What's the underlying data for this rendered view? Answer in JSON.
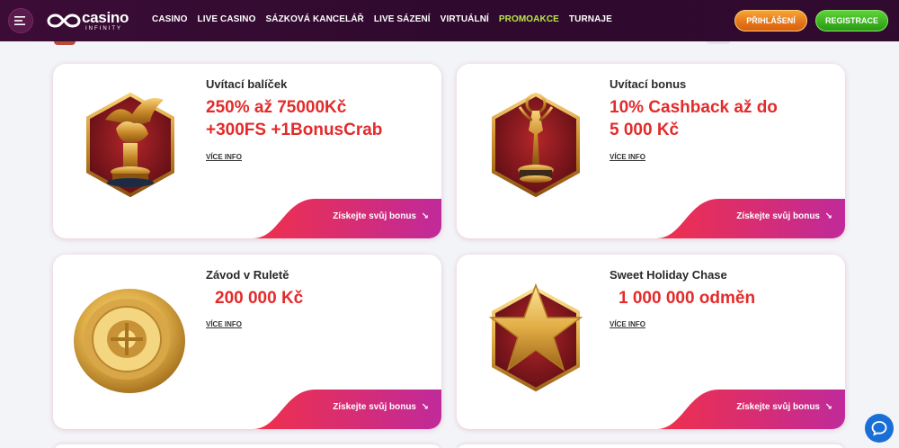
{
  "header": {
    "logo_main": "casino",
    "logo_sub": "INFINITY",
    "nav": [
      {
        "label": "CASINO",
        "active": false
      },
      {
        "label": "LIVE CASINO",
        "active": false
      },
      {
        "label": "SÁZKOVÁ KANCELÁŘ",
        "active": false
      },
      {
        "label": "LIVE SÁZENÍ",
        "active": false
      },
      {
        "label": "VIRTUÁLNÍ",
        "active": false
      },
      {
        "label": "PROMOAKCE",
        "active": true
      },
      {
        "label": "TURNAJE",
        "active": false
      }
    ],
    "login_label": "PŘIHLÁŠENÍ",
    "register_label": "REGISTRACE"
  },
  "cards": [
    {
      "title": "Uvítací balíček",
      "offer_line1": "250% až 75000Kč",
      "offer_line2": "+300FS +1BonusCrab",
      "more": "VÍCE INFO",
      "cta": "Získejte svůj bonus",
      "cta_arrow": "↘",
      "icon": "winged-lion-trophy"
    },
    {
      "title": "Uvítací bonus",
      "offer_line1": "10% Cashback až do",
      "offer_line2": "5 000 Kč",
      "more": "VÍCE INFO",
      "cta": "Získejte svůj bonus",
      "cta_arrow": "↘",
      "icon": "statuette-trophy"
    },
    {
      "title": "Závod v Ruletě",
      "offer_line1": "200 000 Kč",
      "more": "VÍCE INFO",
      "cta": "Získejte svůj bonus",
      "cta_arrow": "↘",
      "icon": "roulette-wheel"
    },
    {
      "title": "Sweet Holiday Chase",
      "offer_line1": "1 000 000 odměn",
      "more": "VÍCE INFO",
      "cta": "Získejte svůj bonus",
      "cta_arrow": "↘",
      "icon": "gold-star"
    }
  ],
  "colors": {
    "header_bg": "#2f0a2e",
    "nav_active": "#b9e64a",
    "offer_red": "#e32b2b",
    "cta_gradient_start": "#f0304a",
    "cta_gradient_end": "#c02a9a",
    "chat_blue": "#1a6fd6"
  },
  "chat_icon": "chat-bubble-icon"
}
